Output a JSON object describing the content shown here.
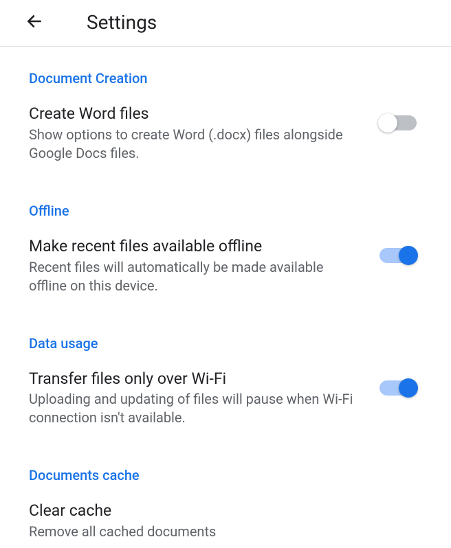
{
  "header": {
    "title": "Settings"
  },
  "sections": {
    "documentCreation": {
      "header": "Document Creation",
      "item": {
        "title": "Create Word files",
        "desc": "Show options to create Word (.docx) files alongside Google Docs files.",
        "enabled": false
      }
    },
    "offline": {
      "header": "Offline",
      "item": {
        "title": "Make recent files available offline",
        "desc": "Recent files will automatically be made available offline on this device.",
        "enabled": true
      }
    },
    "dataUsage": {
      "header": "Data usage",
      "item": {
        "title": "Transfer files only over Wi-Fi",
        "desc": "Uploading and updating of files will pause when Wi-Fi connection isn't available.",
        "enabled": true
      }
    },
    "documentsCache": {
      "header": "Documents cache",
      "item": {
        "title": "Clear cache",
        "desc": "Remove all cached documents"
      }
    }
  }
}
